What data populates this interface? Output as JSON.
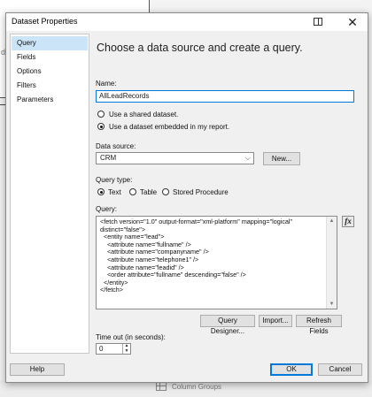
{
  "background": {
    "fragment_char": "d",
    "bottom_label": "Column Groups"
  },
  "dialog": {
    "title": "Dataset Properties",
    "close_glyph": "✕"
  },
  "nav": {
    "items": [
      {
        "label": "Query",
        "selected": true
      },
      {
        "label": "Fields",
        "selected": false
      },
      {
        "label": "Options",
        "selected": false
      },
      {
        "label": "Filters",
        "selected": false
      },
      {
        "label": "Parameters",
        "selected": false
      }
    ]
  },
  "main": {
    "heading": "Choose a data source and create a query.",
    "name_label": "Name:",
    "name_value": "AllLeadRecords",
    "radio_shared": "Use a shared dataset.",
    "radio_embedded": "Use a dataset embedded in my report.",
    "radio_selected": "embedded",
    "datasource_label": "Data source:",
    "datasource_value": "CRM",
    "new_button": "New...",
    "querytype_label": "Query type:",
    "qt_text": "Text",
    "qt_table": "Table",
    "qt_stored": "Stored Procedure",
    "querytype_selected": "Text",
    "query_label": "Query:",
    "query_text": "<fetch version=\"1.0\" output-format=\"xml-platform\" mapping=\"logical\"\ndistinct=\"false\">\n  <entity name=\"lead\">\n    <attribute name=\"fullname\" />\n    <attribute name=\"companyname\" />\n    <attribute name=\"telephone1\" />\n    <attribute name=\"leadid\" />\n    <order attribute=\"fullname\" descending=\"false\" />\n  </entity>\n</fetch>",
    "fx_label": "fx",
    "query_designer_button": "Query Designer...",
    "import_button": "Import...",
    "refresh_fields_button": "Refresh Fields",
    "timeout_label": "Time out (in seconds):",
    "timeout_value": "0"
  },
  "footer": {
    "help": "Help",
    "ok": "OK",
    "cancel": "Cancel"
  },
  "colors": {
    "accent": "#0078d7",
    "nav_selected": "#cce4f7"
  }
}
